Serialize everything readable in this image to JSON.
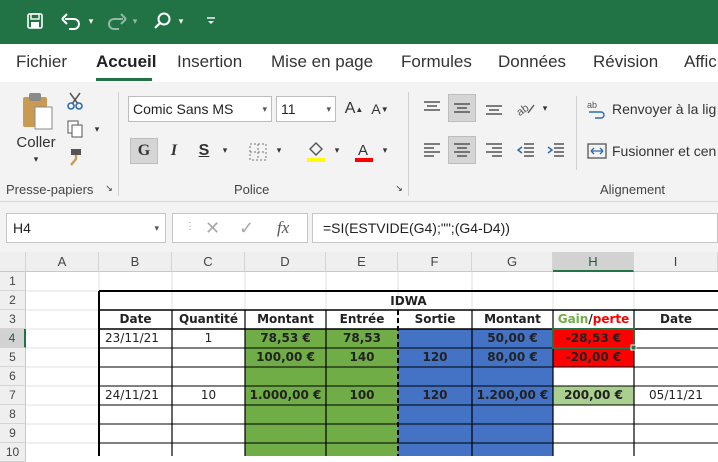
{
  "titlebar": {
    "icons": [
      "save-icon",
      "undo-icon",
      "redo-icon",
      "search-icon",
      "customize-toolbar-icon"
    ],
    "color": "#217346"
  },
  "menu": {
    "tabs": [
      "Fichier",
      "Accueil",
      "Insertion",
      "Mise en page",
      "Formules",
      "Données",
      "Révision",
      "Affic"
    ],
    "active": "Accueil"
  },
  "ribbon": {
    "paste_label": "Coller",
    "clipboard_group": "Presse-papiers",
    "font_name": "Comic Sans MS",
    "font_size": "11",
    "bold": "G",
    "italic": "I",
    "underline": "S",
    "grow_font": "A",
    "shrink_font": "A",
    "font_group": "Police",
    "wrap_text": "Renvoyer à la lig",
    "merge_center": "Fusionner et cen",
    "alignment_group": "Alignement",
    "fill_color": "#ffff00",
    "font_color": "#ff0000"
  },
  "formula_bar": {
    "name_box": "H4",
    "fx_label": "fx",
    "formula": "=SI(ESTVIDE(G4);\"\";(G4-D4))"
  },
  "sheet": {
    "columns": [
      "A",
      "B",
      "C",
      "D",
      "E",
      "F",
      "G",
      "H",
      "I"
    ],
    "selected_column": "H",
    "rows": [
      "1",
      "2",
      "3",
      "4",
      "5",
      "6",
      "7",
      "8",
      "9",
      "10"
    ],
    "selected_row": "4",
    "title": "IDWA",
    "headers": {
      "date": "Date",
      "quantite": "Quantité",
      "montant": "Montant",
      "entree": "Entrée",
      "sortie": "Sortie",
      "montant2": "Montant",
      "gain": "Gain",
      "slash": "/",
      "perte": "perte",
      "date2": "Date"
    },
    "r4": {
      "date": "23/11/21",
      "qte": "1",
      "montant": "78,53 €",
      "entree": "78,53",
      "sortie": "",
      "montant2": "50,00 €",
      "gain": "-28,53 €",
      "date2": ""
    },
    "r5": {
      "date": "",
      "qte": "",
      "montant": "100,00 €",
      "entree": "140",
      "sortie": "120",
      "montant2": "80,00 €",
      "gain": "-20,00 €",
      "date2": ""
    },
    "r7": {
      "date": "24/11/21",
      "qte": "10",
      "montant": "1.000,00 €",
      "entree": "100",
      "sortie": "120",
      "montant2": "1.200,00 €",
      "gain": "200,00 €",
      "date2": "05/11/21"
    },
    "colors": {
      "green": "#70ad47",
      "blue": "#4472c4",
      "red": "#ff0000",
      "light_green": "#a9d08e",
      "gain_text": "#70ad47",
      "perte_text": "#ff0000"
    }
  }
}
